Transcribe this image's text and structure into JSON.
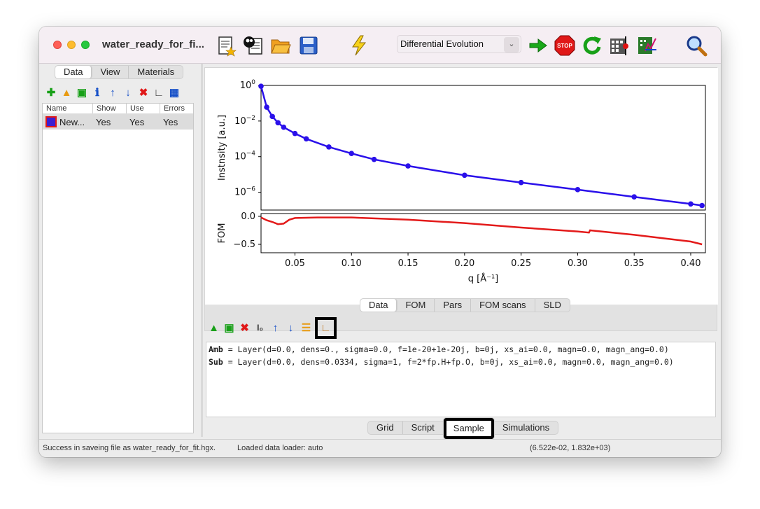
{
  "window": {
    "title": "water_ready_for_fi..."
  },
  "toolbar": {
    "algorithm": "Differential Evolution",
    "icons": [
      "new-model-icon",
      "open-example-icon",
      "open-icon",
      "save-icon",
      "simulate-icon",
      "start-fit-icon",
      "stop-icon",
      "restart-icon",
      "calculate-errors-icon",
      "parameter-scan-icon",
      "zoom-icon"
    ]
  },
  "left_panel": {
    "tabs": [
      "Data",
      "View",
      "Materials"
    ],
    "active_tab": "Data",
    "columns": [
      "Name",
      "Show",
      "Use",
      "Errors"
    ],
    "rows": [
      {
        "name": "New...",
        "show": "Yes",
        "use": "Yes",
        "errors": "Yes",
        "color": "#3c1fd0"
      }
    ]
  },
  "chart_data": {
    "type": "line",
    "panels": [
      {
        "ylabel": "Instnsity [a.u.]",
        "yscale": "log",
        "yticks": [
          "10^0",
          "10^-2",
          "10^-4",
          "10^-6"
        ],
        "ytick_values": [
          1,
          0.01,
          0.0001,
          1e-06
        ],
        "ylim": [
          1e-07,
          1
        ],
        "series": [
          {
            "color": "#2a10ea",
            "x": [
              0.02,
              0.025,
              0.03,
              0.035,
              0.04,
              0.05,
              0.06,
              0.08,
              0.1,
              0.12,
              0.15,
              0.2,
              0.25,
              0.3,
              0.35,
              0.4,
              0.41
            ],
            "y": [
              0.9,
              0.06,
              0.018,
              0.008,
              0.0045,
              0.002,
              0.001,
              0.00035,
              0.00015,
              7e-05,
              3e-05,
              9e-06,
              3.5e-06,
              1.4e-06,
              5.5e-07,
              2.2e-07,
              1.8e-07
            ]
          }
        ]
      },
      {
        "ylabel": "FOM",
        "yticks": [
          "0.0",
          "−0.5"
        ],
        "ytick_values": [
          0,
          -0.5
        ],
        "ylim": [
          -0.65,
          0.05
        ],
        "series": [
          {
            "color": "#e31a1a",
            "x": [
              0.02,
              0.025,
              0.03,
              0.035,
              0.04,
              0.045,
              0.05,
              0.07,
              0.1,
              0.15,
              0.2,
              0.25,
              0.3,
              0.31,
              0.311,
              0.35,
              0.4,
              0.41
            ],
            "y": [
              -0.02,
              -0.07,
              -0.1,
              -0.14,
              -0.13,
              -0.06,
              -0.03,
              -0.02,
              -0.02,
              -0.06,
              -0.12,
              -0.2,
              -0.27,
              -0.29,
              -0.25,
              -0.33,
              -0.45,
              -0.5
            ]
          }
        ]
      }
    ],
    "xlabel": "q [Å⁻¹]",
    "xticks": [
      "0.05",
      "0.10",
      "0.15",
      "0.20",
      "0.25",
      "0.30",
      "0.35",
      "0.40"
    ],
    "xtick_values": [
      0.05,
      0.1,
      0.15,
      0.2,
      0.25,
      0.3,
      0.35,
      0.4
    ],
    "xlim": [
      0.02,
      0.413
    ]
  },
  "plot_tabs": [
    "Data",
    "FOM",
    "Pars",
    "FOM scans",
    "SLD"
  ],
  "plot_active_tab": "Data",
  "script": {
    "lines": [
      {
        "name": "Amb",
        "text": " = Layer(d=0.0, dens=0., sigma=0.0, f=1e-20+1e-20j, b=0j, xs_ai=0.0, magn=0.0, magn_ang=0.0)"
      },
      {
        "name": "Sub",
        "text": " = Layer(d=0.0, dens=0.0334, sigma=1, f=2*fp.H+fp.O, b=0j, xs_ai=0.0, magn=0.0, magn_ang=0.0)"
      }
    ]
  },
  "bottom_tabs": [
    "Grid",
    "Script",
    "Sample",
    "Simulations"
  ],
  "bottom_active_tab": "Sample",
  "status": {
    "message": "Success in saveing file as water_ready_for_fit.hgx.",
    "loader": "Loaded data loader: auto",
    "coords": "(6.522e-02, 1.832e+03)"
  }
}
